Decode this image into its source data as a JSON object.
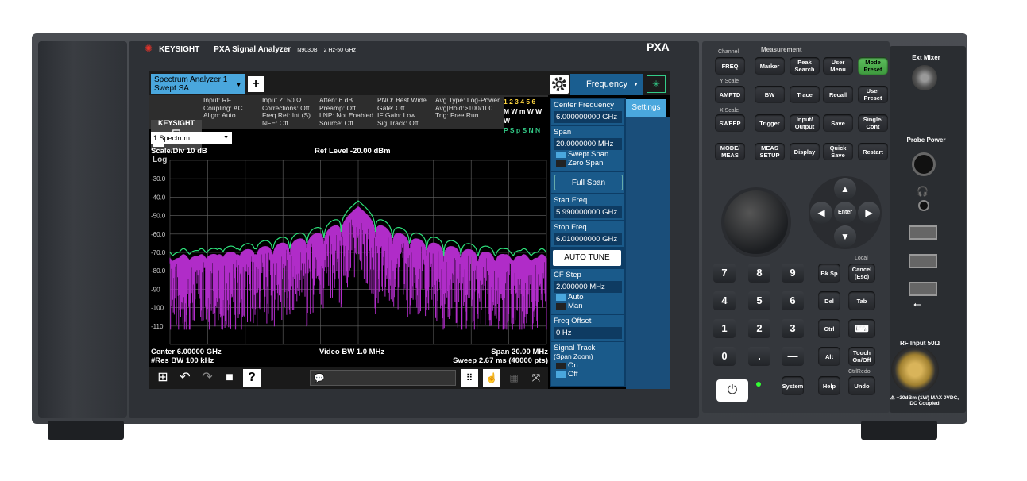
{
  "instrument": {
    "brand": "KEYSIGHT",
    "model_name": "PXA Signal Analyzer",
    "model_number": "N9030B",
    "freq_range": "2 Hz-50 GHz",
    "badge": "PXA"
  },
  "screen": {
    "tab": {
      "line1": "Spectrum Analyzer 1",
      "line2": "Swept SA"
    },
    "add_label": "+",
    "menu": "Frequency",
    "info": {
      "brand": "KEYSIGHT",
      "col1": [
        "Input: RF",
        "Coupling: AC",
        "Align: Auto"
      ],
      "col2": [
        "Input Z: 50 Ω",
        "Corrections: Off",
        "Freq Ref: Int (S)",
        "NFE: Off"
      ],
      "col3": [
        "Atten: 6 dB",
        "Preamp: Off",
        "LNP: Not Enabled",
        "Source: Off"
      ],
      "col4": [
        "PNO: Best Wide",
        "Gate: Off",
        "IF Gain: Low",
        "Sig Track: Off"
      ],
      "col5": [
        "Avg Type: Log-Power",
        "Avg|Hold:>100/100",
        "Trig: Free Run"
      ],
      "trace_numbers": "1 2 3 4 5 6",
      "trace_types": "M W m W W W",
      "trace_dets": "P S p S N N"
    },
    "view": "1 Spectrum",
    "scale": "Scale/Div 10 dB",
    "log": "Log",
    "ref_level": "Ref Level -20.00 dBm",
    "y_ticks": [
      "-30.0",
      "-40.0",
      "-50.0",
      "-60.0",
      "-70.0",
      "-80.0",
      "-90",
      "-100",
      "-110"
    ],
    "center": "Center 6.00000 GHz",
    "res_bw": "#Res BW 100 kHz",
    "video_bw": "Video BW 1.0 MHz",
    "span": "Span 20.00 MHz",
    "sweep": "Sweep 2.67 ms (40000 pts)",
    "softkeys": {
      "center_freq": {
        "label": "Center Frequency",
        "value": "6.000000000 GHz"
      },
      "span": {
        "label": "Span",
        "value": "20.0000000 MHz"
      },
      "swept_span": "Swept Span",
      "zero_span": "Zero Span",
      "full_span": "Full Span",
      "start_freq": {
        "label": "Start Freq",
        "value": "5.990000000 GHz"
      },
      "stop_freq": {
        "label": "Stop Freq",
        "value": "6.010000000 GHz"
      },
      "auto_tune": "AUTO TUNE",
      "cf_step": {
        "label": "CF Step",
        "value": "2.000000 MHz"
      },
      "auto": "Auto",
      "man": "Man",
      "freq_offset": {
        "label": "Freq Offset",
        "value": "0 Hz"
      },
      "signal_track": {
        "label": "Signal Track",
        "sub": "(Span Zoom)"
      },
      "on": "On",
      "off": "Off"
    },
    "settings_tab": "Settings"
  },
  "hardkeys": {
    "channel": "Channel",
    "measurement": "Measurement",
    "y_scale": "Y Scale",
    "x_scale": "X Scale",
    "freq": "FREQ",
    "marker": "Marker",
    "peak_search": "Peak Search",
    "user_menu": "User Menu",
    "mode_preset": "Mode Preset",
    "amptd": "AMPTD",
    "bw": "BW",
    "trace": "Trace",
    "recall": "Recall",
    "user_preset": "User Preset",
    "sweep": "SWEEP",
    "trigger": "Trigger",
    "input_output": "Input/ Output",
    "save": "Save",
    "single_cont": "Single/ Cont",
    "mode_meas": "MODE/ MEAS",
    "meas_setup": "MEAS SETUP",
    "display": "Display",
    "quick_save": "Quick Save",
    "restart": "Restart",
    "enter": "Enter",
    "local": "Local",
    "bk_sp": "Bk Sp",
    "cancel": "Cancel (Esc)",
    "del": "Del",
    "tab": "Tab",
    "ctrl": "Ctrl",
    "alt": "Alt",
    "touch": "Touch On/Off",
    "system": "System",
    "help": "Help",
    "undo": "Undo",
    "ctrl_redo": "CtrlRedo",
    "digits": [
      "7",
      "8",
      "9",
      "4",
      "5",
      "6",
      "1",
      "2",
      "3",
      "0",
      ".",
      "—"
    ]
  },
  "io": {
    "ext_mixer": "Ext Mixer",
    "probe_power": "Probe Power",
    "rf_input": "RF Input 50Ω",
    "warning": "⚠ +30dBm (1W) MAX 0VDC, DC Coupled"
  }
}
